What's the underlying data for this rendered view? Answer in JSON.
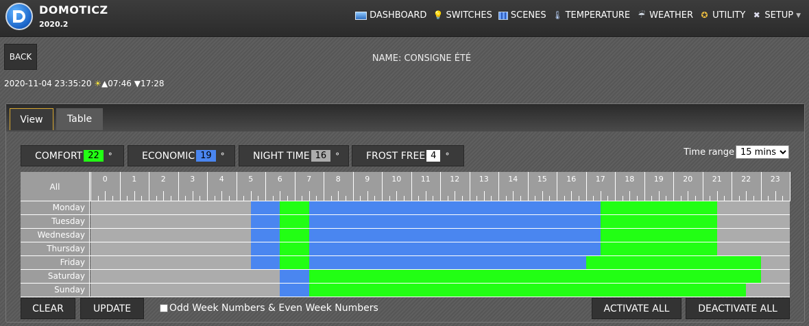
{
  "app": {
    "title": "DOMOTICZ",
    "version": "2020.2"
  },
  "nav": [
    {
      "label": "DASHBOARD",
      "icon": "dashboard-icon"
    },
    {
      "label": "SWITCHES",
      "icon": "lightbulb-icon"
    },
    {
      "label": "SCENES",
      "icon": "scenes-icon"
    },
    {
      "label": "TEMPERATURE",
      "icon": "thermometer-icon"
    },
    {
      "label": "WEATHER",
      "icon": "weather-icon"
    },
    {
      "label": "UTILITY",
      "icon": "utility-icon"
    },
    {
      "label": "SETUP",
      "icon": "tools-icon"
    }
  ],
  "back_label": "BACK",
  "device_name": "NAME: CONSIGNE ÉTÉ",
  "datetime": "2020-11-04 23:35:20",
  "sunrise": "07:46",
  "sunset": "17:28",
  "tabs": {
    "view": "View",
    "table": "Table"
  },
  "modes": [
    {
      "label": "COMFORT",
      "value": "22",
      "unit": "°",
      "color": "#22ff14"
    },
    {
      "label": "ECONOMIC",
      "value": "19",
      "unit": "°",
      "color": "#4a86f0"
    },
    {
      "label": "NIGHT TIME",
      "value": "16",
      "unit": "°",
      "color": "#acacac"
    },
    {
      "label": "FROST FREE",
      "value": "4",
      "unit": "°",
      "color": "#ffffff"
    }
  ],
  "time_range": {
    "label": "Time range",
    "selected": "15 mins"
  },
  "grid": {
    "all_label": "All",
    "hours": [
      "0",
      "1",
      "2",
      "3",
      "4",
      "5",
      "6",
      "7",
      "8",
      "9",
      "10",
      "11",
      "12",
      "13",
      "14",
      "15",
      "16",
      "17",
      "18",
      "19",
      "20",
      "21",
      "22",
      "23"
    ],
    "days": [
      {
        "name": "Monday",
        "segments": [
          {
            "from": 5.5,
            "to": 6.5,
            "mode": "economic"
          },
          {
            "from": 6.5,
            "to": 7.5,
            "mode": "comfort"
          },
          {
            "from": 7.5,
            "to": 17.5,
            "mode": "economic"
          },
          {
            "from": 17.5,
            "to": 21.5,
            "mode": "comfort"
          }
        ]
      },
      {
        "name": "Tuesday",
        "segments": [
          {
            "from": 5.5,
            "to": 6.5,
            "mode": "economic"
          },
          {
            "from": 6.5,
            "to": 7.5,
            "mode": "comfort"
          },
          {
            "from": 7.5,
            "to": 17.5,
            "mode": "economic"
          },
          {
            "from": 17.5,
            "to": 21.5,
            "mode": "comfort"
          }
        ]
      },
      {
        "name": "Wednesday",
        "segments": [
          {
            "from": 5.5,
            "to": 6.5,
            "mode": "economic"
          },
          {
            "from": 6.5,
            "to": 7.5,
            "mode": "comfort"
          },
          {
            "from": 7.5,
            "to": 17.5,
            "mode": "economic"
          },
          {
            "from": 17.5,
            "to": 21.5,
            "mode": "comfort"
          }
        ]
      },
      {
        "name": "Thursday",
        "segments": [
          {
            "from": 5.5,
            "to": 6.5,
            "mode": "economic"
          },
          {
            "from": 6.5,
            "to": 7.5,
            "mode": "comfort"
          },
          {
            "from": 7.5,
            "to": 17.5,
            "mode": "economic"
          },
          {
            "from": 17.5,
            "to": 21.5,
            "mode": "comfort"
          }
        ]
      },
      {
        "name": "Friday",
        "segments": [
          {
            "from": 5.5,
            "to": 6.5,
            "mode": "economic"
          },
          {
            "from": 6.5,
            "to": 7.5,
            "mode": "comfort"
          },
          {
            "from": 7.5,
            "to": 17,
            "mode": "economic"
          },
          {
            "from": 17,
            "to": 23,
            "mode": "comfort"
          }
        ]
      },
      {
        "name": "Saturday",
        "segments": [
          {
            "from": 6.5,
            "to": 7.5,
            "mode": "economic"
          },
          {
            "from": 7.5,
            "to": 23,
            "mode": "comfort"
          }
        ]
      },
      {
        "name": "Sunday",
        "segments": [
          {
            "from": 6.5,
            "to": 7.5,
            "mode": "economic"
          },
          {
            "from": 7.5,
            "to": 22.5,
            "mode": "comfort"
          }
        ]
      }
    ]
  },
  "buttons": {
    "clear": "CLEAR",
    "update": "UPDATE",
    "activate_all": "ACTIVATE ALL",
    "deactivate_all": "DEACTIVATE ALL"
  },
  "odd_even_label": "Odd Week Numbers & Even Week Numbers"
}
